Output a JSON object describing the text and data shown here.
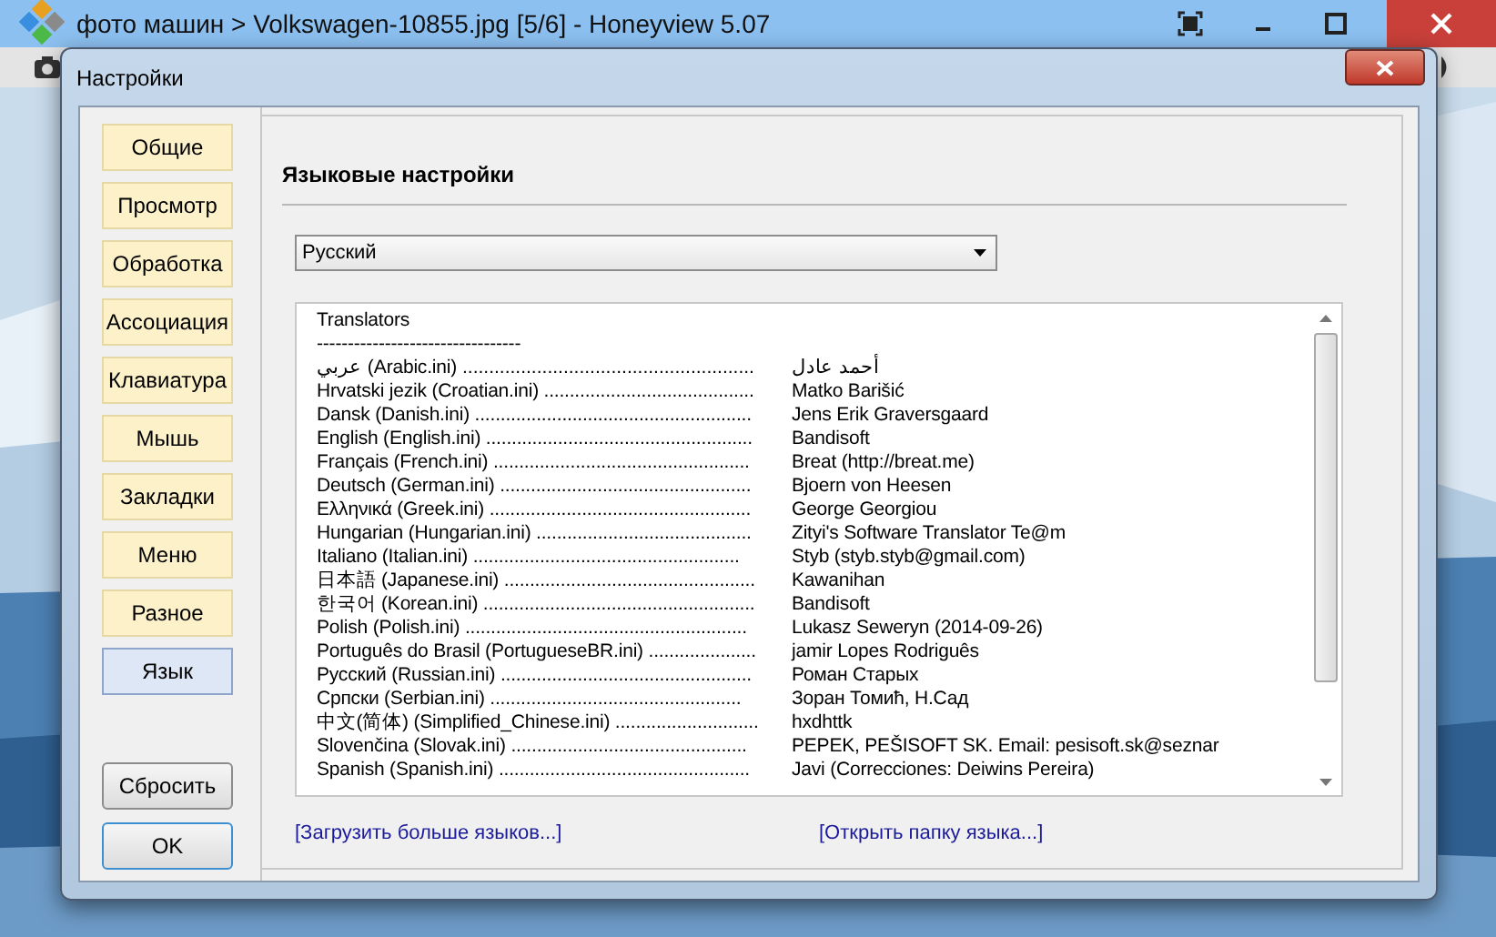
{
  "window": {
    "title": "фото машин > Volkswagen-10855.jpg [5/6] - Honeyview 5.07"
  },
  "dialog": {
    "title": "Настройки",
    "categories": [
      {
        "label": "Общие",
        "selected": false
      },
      {
        "label": "Просмотр",
        "selected": false
      },
      {
        "label": "Обработка",
        "selected": false
      },
      {
        "label": "Ассоциация",
        "selected": false
      },
      {
        "label": "Клавиатура",
        "selected": false
      },
      {
        "label": "Мышь",
        "selected": false
      },
      {
        "label": "Закладки",
        "selected": false
      },
      {
        "label": "Меню",
        "selected": false
      },
      {
        "label": "Разное",
        "selected": false
      },
      {
        "label": "Язык",
        "selected": true
      }
    ],
    "buttons": [
      "Сбросить",
      "OK"
    ],
    "section_title": "Языковые настройки",
    "language_dropdown": {
      "value": "Русский"
    },
    "translators": {
      "heading": "Translators",
      "separator": "---------------------------------",
      "rows": [
        {
          "language": "عربي (Arabic.ini)",
          "leader": ".......................................................",
          "translator": "أحمد عادل"
        },
        {
          "language": "Hrvatski jezik (Croatian.ini)",
          "leader": ".........................................",
          "translator": "Matko Barišić"
        },
        {
          "language": "Dansk (Danish.ini)",
          "leader": "......................................................",
          "translator": "Jens Erik Graversgaard"
        },
        {
          "language": "English (English.ini)",
          "leader": "....................................................",
          "translator": "Bandisoft"
        },
        {
          "language": "Français (French.ini)",
          "leader": "..................................................",
          "translator": "Breat (http://breat.me)"
        },
        {
          "language": "Deutsch (German.ini)",
          "leader": ".................................................",
          "translator": "Bjoern von Heesen"
        },
        {
          "language": "Ελληνικά (Greek.ini)",
          "leader": "...................................................",
          "translator": "George Georgiou"
        },
        {
          "language": "Hungarian (Hungarian.ini)",
          "leader": "..........................................",
          "translator": "Zityi's Software Translator Te@m"
        },
        {
          "language": "Italiano (Italian.ini)",
          "leader": "....................................................",
          "translator": "Styb (styb.styb@gmail.com)"
        },
        {
          "language": "日本語 (Japanese.ini)",
          "leader": ".................................................",
          "translator": "Kawanihan"
        },
        {
          "language": "한국어 (Korean.ini)",
          "leader": ".....................................................",
          "translator": "Bandisoft"
        },
        {
          "language": "Polish (Polish.ini)",
          "leader": ".......................................................",
          "translator": "Lukasz Seweryn (2014-09-26)"
        },
        {
          "language": "Português do Brasil (PortugueseBR.ini)",
          "leader": ".....................",
          "translator": "jamir Lopes Rodriguês"
        },
        {
          "language": "Русский (Russian.ini)",
          "leader": ".................................................",
          "translator": "Роман Старых"
        },
        {
          "language": "Српски (Serbian.ini)",
          "leader": ".................................................",
          "translator": "Зоран Томић, Н.Сад"
        },
        {
          "language": "中文(简体) (Simplified_Chinese.ini)",
          "leader": "............................",
          "translator": "hxdhttk"
        },
        {
          "language": "Slovenčina (Slovak.ini)",
          "leader": "..............................................",
          "translator": "PEPEK, PEŠISOFT SK. Email: pesisoft.sk@seznar"
        },
        {
          "language": "Spanish (Spanish.ini)",
          "leader": ".................................................",
          "translator": "Javi (Correcciones: Deiwins Pereira)"
        }
      ]
    },
    "links": [
      "[Загрузить больше языков...]",
      "[Открыть папку языка...]"
    ]
  }
}
